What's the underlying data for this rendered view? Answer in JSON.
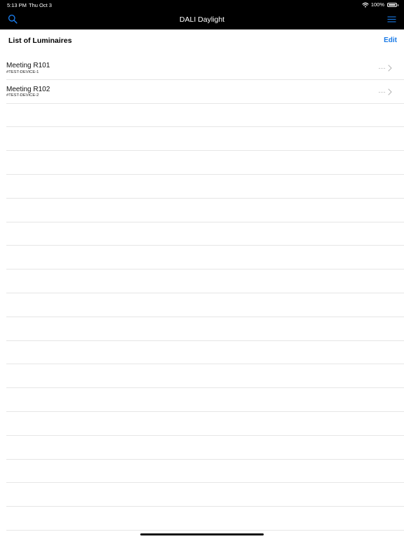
{
  "status_bar": {
    "time": "5:13 PM",
    "date": "Thu Oct 3",
    "battery": "100%"
  },
  "nav": {
    "title": "DALI Daylight",
    "left_icon": "search-icon",
    "right_icon": "menu-icon"
  },
  "section": {
    "title": "List of Luminaires",
    "edit_label": "Edit"
  },
  "luminaires": [
    {
      "name": "Meeting R101",
      "device": "#TEST-DEVICE-1",
      "value": "---"
    },
    {
      "name": "Meeting R102",
      "device": "#TEST-DEVICE-2",
      "value": "---"
    }
  ],
  "colors": {
    "nav_background": "#000000",
    "accent": "#1a7ae6",
    "separator": "#e6e6e6"
  }
}
